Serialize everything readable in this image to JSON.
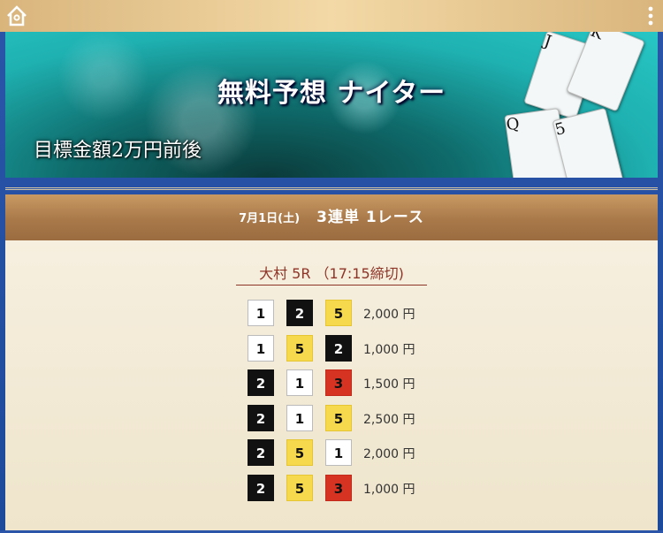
{
  "topbar": {
    "home_icon": "home-icon",
    "menu_icon": "more-vertical-icon"
  },
  "banner": {
    "title": "無料予想 ナイター",
    "subtitle": "目標金額2万円前後",
    "cards": [
      "J",
      "K",
      "Q",
      "5"
    ]
  },
  "header": {
    "date": "7月1日(土)",
    "bet_type": "3連単 1レース"
  },
  "race": {
    "label": "大村 5R （17:15締切)"
  },
  "combos": [
    {
      "n": [
        "1",
        "2",
        "5"
      ],
      "colors": [
        "white",
        "black",
        "yellow"
      ],
      "amount": "2,000 円"
    },
    {
      "n": [
        "1",
        "5",
        "2"
      ],
      "colors": [
        "white",
        "yellow",
        "black"
      ],
      "amount": "1,000 円"
    },
    {
      "n": [
        "2",
        "1",
        "3"
      ],
      "colors": [
        "black",
        "white",
        "red"
      ],
      "amount": "1,500 円"
    },
    {
      "n": [
        "2",
        "1",
        "5"
      ],
      "colors": [
        "black",
        "white",
        "yellow"
      ],
      "amount": "2,500 円"
    },
    {
      "n": [
        "2",
        "5",
        "1"
      ],
      "colors": [
        "black",
        "yellow",
        "white"
      ],
      "amount": "2,000 円"
    },
    {
      "n": [
        "2",
        "5",
        "3"
      ],
      "colors": [
        "black",
        "yellow",
        "red"
      ],
      "amount": "1,000 円"
    }
  ],
  "colors": {
    "accent_brown": "#a9794a",
    "race_red": "#8e3427"
  }
}
